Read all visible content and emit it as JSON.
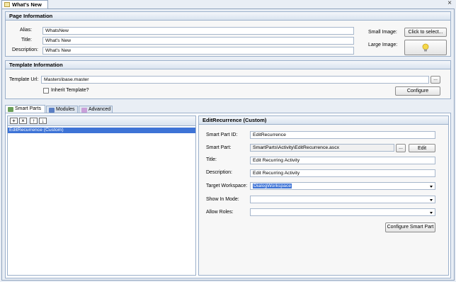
{
  "document_tab": {
    "title": "What's New",
    "close_glyph": "×"
  },
  "page_info": {
    "header": "Page Information",
    "alias_label": "Alias:",
    "alias_value": "WhatsNew",
    "title_label": "Title:",
    "title_value": "What's New",
    "description_label": "Description:",
    "description_value": "What's New",
    "small_image_label": "Small Image:",
    "select_button": "Click to select...",
    "large_image_label": "Large Image:",
    "large_image_icon": "lightbulb-icon"
  },
  "template_info": {
    "header": "Template Information",
    "url_label": "Template Url:",
    "url_value": "Masters\\base.master",
    "browse_button": "...",
    "inherit_label": "Inherit Template?",
    "inherit_checked": false,
    "configure_button": "Configure"
  },
  "tabs": [
    {
      "label": "Smart Parts",
      "active": true,
      "icon": "smart-parts-icon"
    },
    {
      "label": "Modules",
      "active": false,
      "icon": "modules-icon"
    },
    {
      "label": "Advanced",
      "active": false,
      "icon": "advanced-icon"
    }
  ],
  "toolbar": {
    "add": "+",
    "remove": "×",
    "up": "↑",
    "down": "↓"
  },
  "smart_parts_list": [
    "EditRecurrence (Custom)"
  ],
  "detail": {
    "header": "EditRecurrence (Custom)",
    "id_label": "Smart Part ID:",
    "id_value": "EditRecurrence",
    "part_label": "Smart Part:",
    "part_value": "SmartParts\\Activity\\EditRecurrence.ascx",
    "browse_button": "...",
    "edit_button": "Edit",
    "title_label": "Title:",
    "title_value": "Edit Recurring Activity",
    "description_label": "Description:",
    "description_value": "Edit Recurring Activity",
    "workspace_label": "Target Workspace:",
    "workspace_value": "DialogWorkspace",
    "show_mode_label": "Show In Mode:",
    "show_mode_value": "",
    "allow_roles_label": "Allow Roles:",
    "allow_roles_value": "",
    "configure_button": "Configure Smart Part"
  },
  "colors": {
    "accent_selection": "#3d73d6",
    "header_text": "#1f3a6b",
    "lightbulb": "#f5d84a"
  }
}
